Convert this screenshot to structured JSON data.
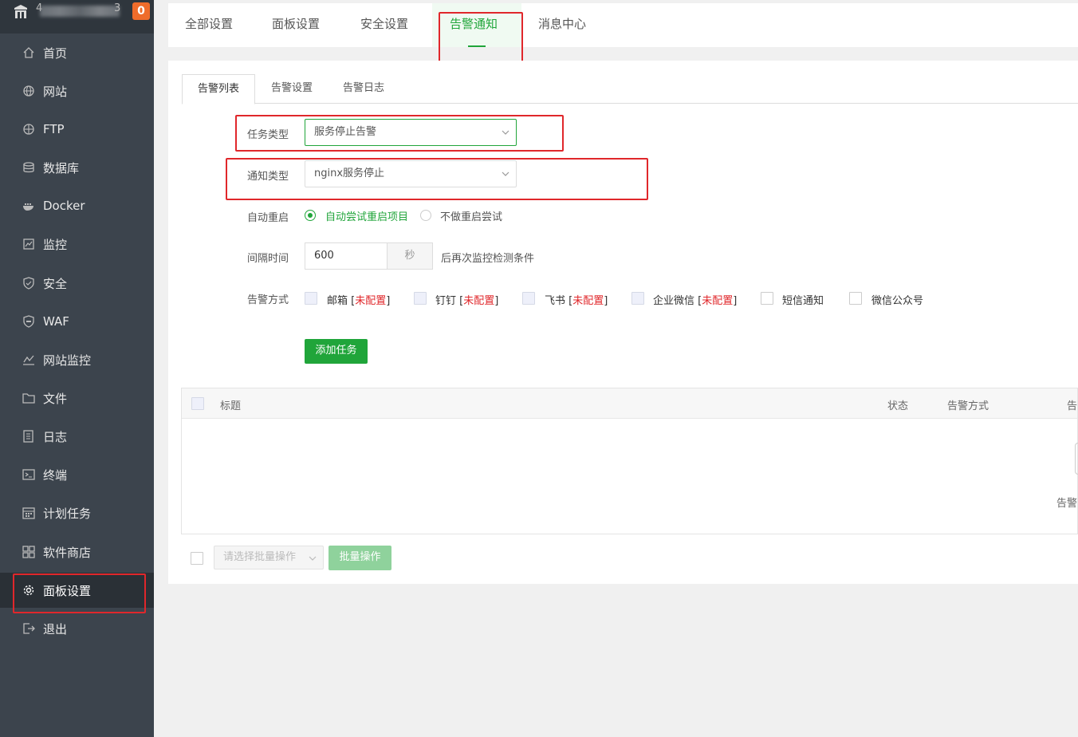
{
  "sidebar": {
    "brand_name": "4",
    "brand_suffix": "3",
    "badge": "0",
    "items": [
      {
        "label": "首页",
        "icon": "home-icon"
      },
      {
        "label": "网站",
        "icon": "globe-icon"
      },
      {
        "label": "FTP",
        "icon": "ftp-icon"
      },
      {
        "label": "数据库",
        "icon": "database-icon"
      },
      {
        "label": "Docker",
        "icon": "docker-icon"
      },
      {
        "label": "监控",
        "icon": "monitor-icon"
      },
      {
        "label": "安全",
        "icon": "shield-icon"
      },
      {
        "label": "WAF",
        "icon": "waf-icon"
      },
      {
        "label": "网站监控",
        "icon": "chart-line-icon"
      },
      {
        "label": "文件",
        "icon": "folder-icon"
      },
      {
        "label": "日志",
        "icon": "log-icon"
      },
      {
        "label": "终端",
        "icon": "terminal-icon"
      },
      {
        "label": "计划任务",
        "icon": "calendar-icon"
      },
      {
        "label": "软件商店",
        "icon": "grid-icon"
      },
      {
        "label": "面板设置",
        "icon": "gear-icon",
        "active": true
      },
      {
        "label": "退出",
        "icon": "logout-icon"
      }
    ]
  },
  "top_tabs": [
    {
      "label": "全部设置"
    },
    {
      "label": "面板设置"
    },
    {
      "label": "安全设置"
    },
    {
      "label": "告警通知",
      "active": true
    },
    {
      "label": "消息中心"
    }
  ],
  "sub_tabs": [
    {
      "label": "告警列表",
      "active": true
    },
    {
      "label": "告警设置"
    },
    {
      "label": "告警日志"
    }
  ],
  "form": {
    "task_type_label": "任务类型",
    "task_type_value": "服务停止告警",
    "notify_type_label": "通知类型",
    "notify_type_value": "nginx服务停止",
    "restart_label": "自动重启",
    "restart_options": [
      "自动尝试重启项目",
      "不做重启尝试"
    ],
    "interval_label": "间隔时间",
    "interval_value": "600",
    "interval_unit": "秒",
    "interval_suffix": "后再次监控检测条件",
    "method_label": "告警方式",
    "methods": [
      {
        "name": "邮箱",
        "status": "未配置"
      },
      {
        "name": "钉钉",
        "status": "未配置"
      },
      {
        "name": "飞书",
        "status": "未配置"
      },
      {
        "name": "企业微信",
        "status": "未配置"
      },
      {
        "name": "短信通知",
        "status": ""
      },
      {
        "name": "微信公众号",
        "status": ""
      }
    ],
    "add_button": "添加任务"
  },
  "table": {
    "columns": [
      "标题",
      "状态",
      "告警方式",
      "告"
    ],
    "empty_text": "告警"
  },
  "batch": {
    "placeholder": "请选择批量操作",
    "button": "批量操作"
  },
  "colors": {
    "accent": "#20a53a",
    "sidebar_bg": "#3c444d",
    "warning": "#e0272b",
    "badge": "#ef6c2b"
  }
}
